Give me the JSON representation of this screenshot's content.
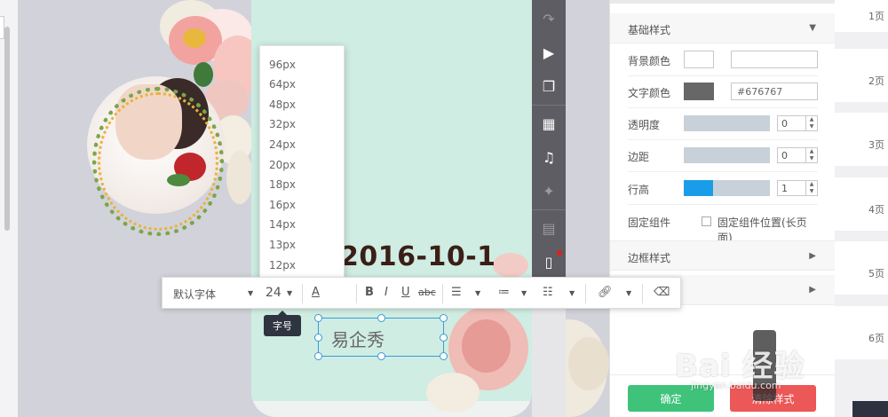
{
  "canvas": {
    "date_text": "2016-10-1",
    "selected_text": "易企秀"
  },
  "font_size_dropdown": {
    "options": [
      "96px",
      "64px",
      "48px",
      "32px",
      "24px",
      "20px",
      "18px",
      "16px",
      "14px",
      "13px",
      "12px"
    ]
  },
  "text_toolbar": {
    "font_family": "默认字体",
    "font_size": "24",
    "font_color_glyph": "A",
    "bold": "B",
    "italic": "I",
    "underline": "U",
    "strike": "abc",
    "tooltip": "字号"
  },
  "side_toolbar": {
    "icons": [
      "redo-icon",
      "play-icon",
      "copy-icon",
      "grid-icon",
      "music-icon",
      "magic-icon",
      "table-icon",
      "phone-icon"
    ]
  },
  "properties": {
    "section_basic": "基础样式",
    "background_color_label": "背景颜色",
    "background_color_value": "",
    "text_color_label": "文字颜色",
    "text_color_value": "#676767",
    "opacity_label": "透明度",
    "opacity_value": "0",
    "padding_label": "边距",
    "padding_value": "0",
    "line_height_label": "行高",
    "line_height_value": "1",
    "line_height_fill_fraction": 0.34,
    "fixed_component_label": "固定组件",
    "fixed_component_checkbox_label": "固定组件位置(长页面)",
    "section_border": "边框样式",
    "confirm_button": "确定",
    "clear_button": "清除样式"
  },
  "pages": {
    "labels": [
      "1页",
      "2页",
      "3页",
      "4页",
      "5页",
      "6页"
    ]
  },
  "colors": {
    "accent_blue": "#1a9de8",
    "confirm_green": "#3fc37b",
    "clear_red": "#ec5757",
    "text_color_swatch": "#676767",
    "toolbar_dark": "#5d5d63",
    "canvas_mint": "#cfede2"
  },
  "watermark": {
    "main": "Bai 经验",
    "sub": "jingyan.baidu.com"
  }
}
